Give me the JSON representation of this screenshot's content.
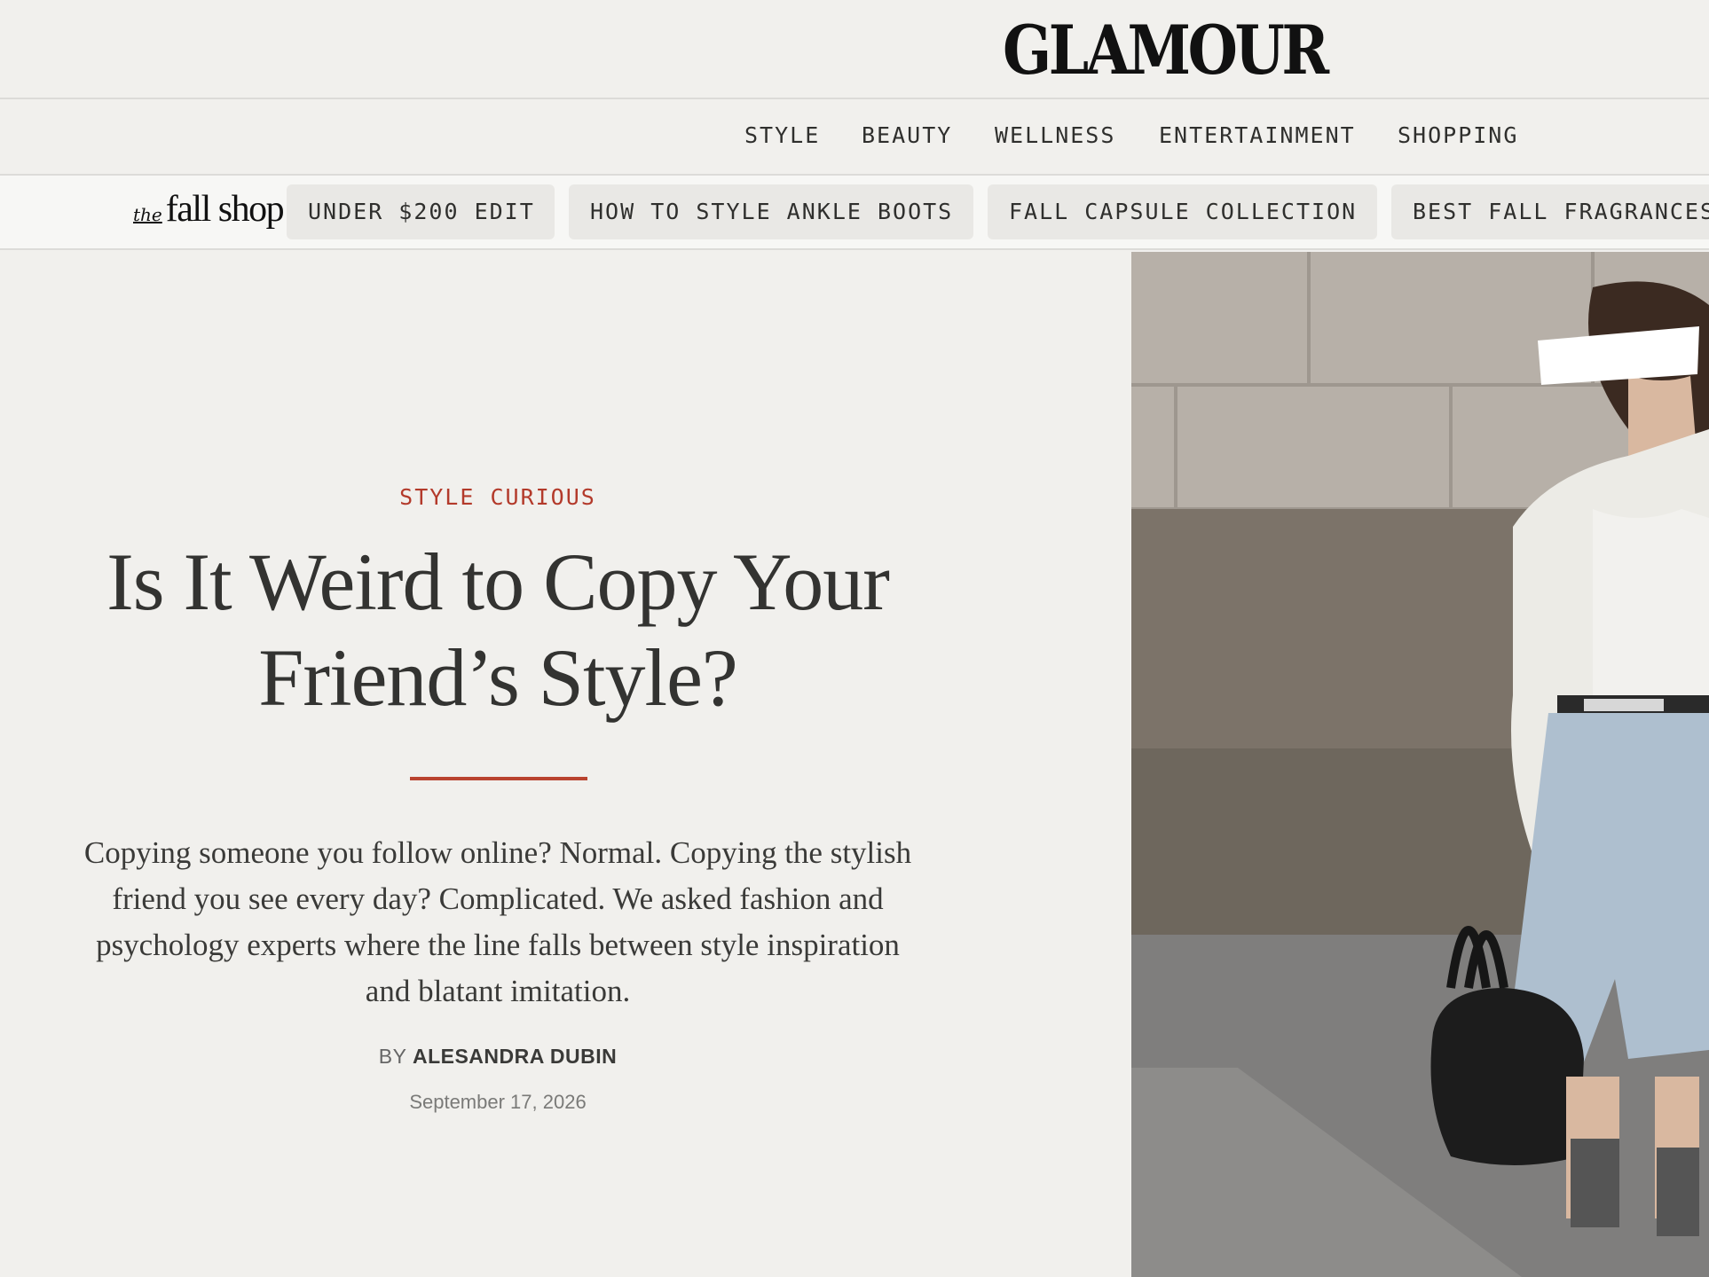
{
  "brand": {
    "logo_text": "GLAMOUR"
  },
  "nav": {
    "items": [
      {
        "label": "STYLE"
      },
      {
        "label": "BEAUTY"
      },
      {
        "label": "WELLNESS"
      },
      {
        "label": "ENTERTAINMENT"
      },
      {
        "label": "SHOPPING"
      }
    ]
  },
  "fall_shop": {
    "logo_the": "the",
    "logo_main": "fall shop",
    "links": [
      {
        "label": "UNDER $200 EDIT"
      },
      {
        "label": "HOW TO STYLE ANKLE BOOTS"
      },
      {
        "label": "FALL CAPSULE COLLECTION"
      },
      {
        "label": "BEST FALL FRAGRANCES"
      }
    ]
  },
  "article": {
    "rubric": "STYLE CURIOUS",
    "headline": "Is It Weird to Copy Your Friend’s Style?",
    "dek": "Copying someone you follow online? Normal. Copying the stylish friend you see every day? Complicated. We asked fashion and psychology experts where the line falls between style inspiration and blatant imitation.",
    "byline_prefix": "BY",
    "author": "ALESANDRA DUBIN",
    "date": "September 17, 2026"
  },
  "colors": {
    "background": "#f1f0ed",
    "accent": "#b33a2b",
    "text": "#2f2f2d"
  }
}
